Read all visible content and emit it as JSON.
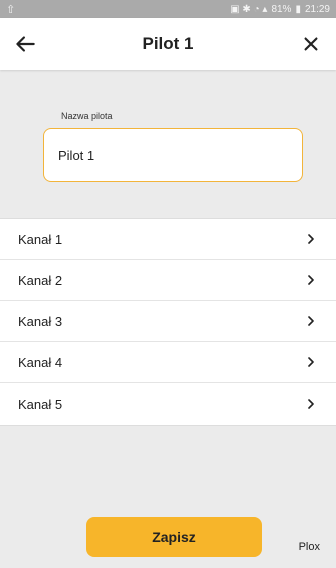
{
  "status_bar": {
    "left_icon": "upload-icon",
    "battery": "81%",
    "time": "21:29"
  },
  "header": {
    "title": "Pilot 1",
    "back_icon": "arrow-left-icon",
    "close_icon": "close-icon"
  },
  "name_field": {
    "label": "Nazwa pilota",
    "value": "Pilot 1"
  },
  "channels": [
    {
      "label": "Kanał 1"
    },
    {
      "label": "Kanał 2"
    },
    {
      "label": "Kanał 3"
    },
    {
      "label": "Kanał 4"
    },
    {
      "label": "Kanał 5"
    }
  ],
  "footer": {
    "save_label": "Zapisz",
    "brand": "Plox"
  },
  "colors": {
    "accent": "#f7b52a",
    "field_border": "#f2b43a",
    "background": "#ebebeb"
  }
}
